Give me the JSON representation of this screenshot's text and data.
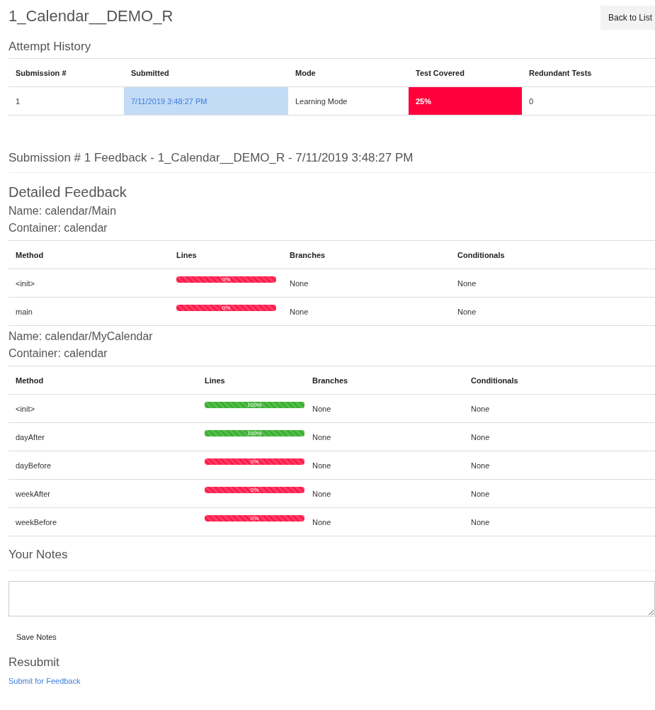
{
  "title": "1_Calendar__DEMO_R",
  "back_button": "Back to List",
  "attempt_history": {
    "heading": "Attempt History",
    "columns": [
      "Submission #",
      "Submitted",
      "Mode",
      "Test Covered",
      "Redundant Tests"
    ],
    "rows": [
      {
        "number": "1",
        "submitted": "7/11/2019 3:48:27 PM",
        "mode": "Learning Mode",
        "test_covered": "25%",
        "redundant_tests": "0"
      }
    ]
  },
  "feedback_heading": "Submission # 1 Feedback - 1_Calendar__DEMO_R - 7/11/2019 3:48:27 PM",
  "detailed_heading": "Detailed Feedback",
  "classes": [
    {
      "name": "Name: calendar/Main",
      "container": "Container: calendar",
      "columns": [
        "Method",
        "Lines",
        "Branches",
        "Conditionals"
      ],
      "methods": [
        {
          "method": "<init>",
          "level": 0,
          "lines": "0%",
          "branches": "None",
          "conditionals": "None"
        },
        {
          "method": "main",
          "level": 0,
          "lines": "0%",
          "branches": "None",
          "conditionals": "None"
        }
      ]
    },
    {
      "name": "Name: calendar/MyCalendar",
      "container": "Container: calendar",
      "columns": [
        "Method",
        "Lines",
        "Branches",
        "Conditionals"
      ],
      "methods": [
        {
          "method": "<init>",
          "level": 1,
          "lines": "100%",
          "branches": "None",
          "conditionals": "None"
        },
        {
          "method": "dayAfter",
          "level": 1,
          "lines": "100%",
          "branches": "None",
          "conditionals": "None"
        },
        {
          "method": "dayBefore",
          "level": 0,
          "lines": "0%",
          "branches": "None",
          "conditionals": "None"
        },
        {
          "method": "weekAfter",
          "level": 0,
          "lines": "0%",
          "branches": "None",
          "conditionals": "None"
        },
        {
          "method": "weekBefore",
          "level": 0,
          "lines": "0%",
          "branches": "None",
          "conditionals": "None"
        }
      ]
    }
  ],
  "notes": {
    "heading": "Your Notes",
    "save_button": "Save Notes"
  },
  "resubmit": {
    "heading": "Resubmit",
    "link": "Submit for Feedback"
  }
}
